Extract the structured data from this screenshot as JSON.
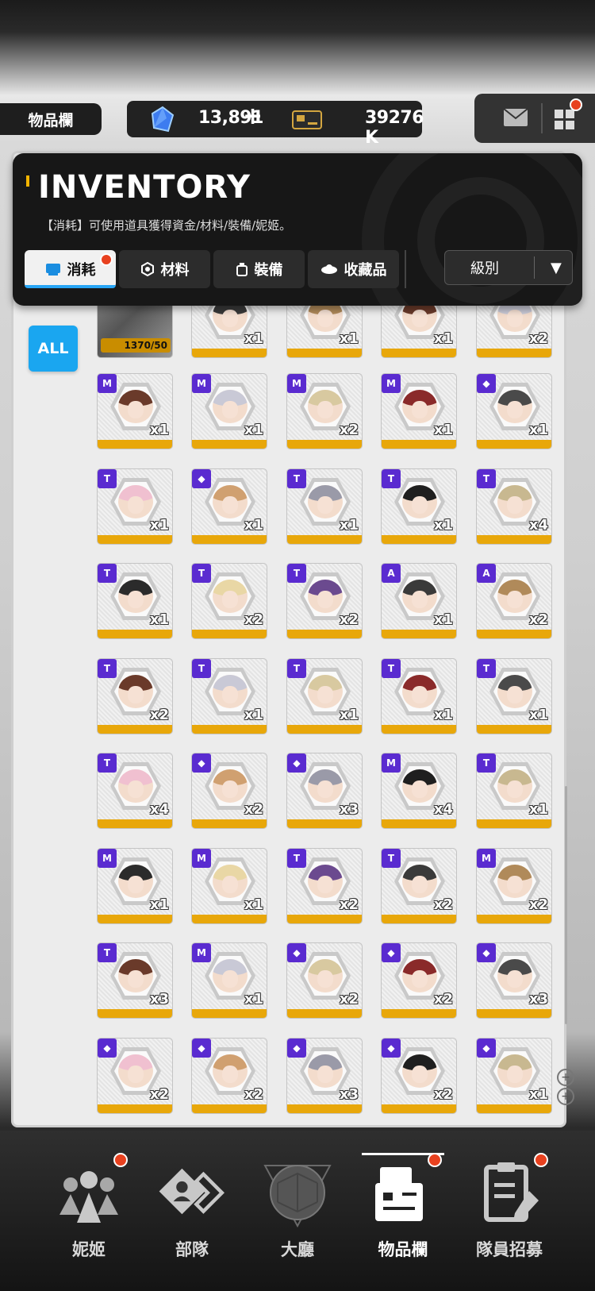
{
  "header": {
    "page_title": "物品欄",
    "gems": "13,891",
    "plus": "+",
    "credits": "39276 K"
  },
  "inventory": {
    "title": "INVENTORY",
    "description": "【消耗】可使用道具獲得資金/材料/裝備/妮姬。",
    "tabs": [
      "消耗",
      "材料",
      "裝備",
      "收藏品"
    ],
    "active_tab": 0,
    "sort_label": "級別",
    "filter_all": "ALL"
  },
  "partial_row": {
    "progress_text": "1370/50",
    "quantities": [
      "x1",
      "x1",
      "x1",
      "x2"
    ]
  },
  "rows": [
    {
      "badges": [
        "M",
        "M",
        "M",
        "M",
        "◆"
      ],
      "quantities": [
        "x1",
        "x1",
        "x2",
        "x1",
        "x1"
      ]
    },
    {
      "badges": [
        "T",
        "◆",
        "T",
        "T",
        "T"
      ],
      "quantities": [
        "x1",
        "x1",
        "x1",
        "x1",
        "x4"
      ]
    },
    {
      "badges": [
        "T",
        "T",
        "T",
        "A",
        "A"
      ],
      "quantities": [
        "x1",
        "x2",
        "x2",
        "x1",
        "x2"
      ]
    },
    {
      "badges": [
        "T",
        "T",
        "T",
        "T",
        "T"
      ],
      "quantities": [
        "x2",
        "x1",
        "x1",
        "x1",
        "x1"
      ]
    },
    {
      "badges": [
        "T",
        "◆",
        "◆",
        "M",
        "T"
      ],
      "quantities": [
        "x4",
        "x2",
        "x3",
        "x4",
        "x1"
      ]
    },
    {
      "badges": [
        "M",
        "M",
        "T",
        "T",
        "M"
      ],
      "quantities": [
        "x1",
        "x1",
        "x2",
        "x2",
        "x2"
      ]
    },
    {
      "badges": [
        "T",
        "M",
        "◆",
        "◆",
        "◆"
      ],
      "quantities": [
        "x3",
        "x1",
        "x2",
        "x2",
        "x3"
      ]
    },
    {
      "badges": [
        "◆",
        "◆",
        "◆",
        "◆",
        "◆"
      ],
      "quantities": [
        "x2",
        "x2",
        "x3",
        "x2",
        "x1"
      ]
    }
  ],
  "colors": {
    "accent_blue": "#1aa6f0",
    "card_yellow": "#e8a70a",
    "badge_purple": "#5a2bd0",
    "notify_red": "#e8411f"
  },
  "bottom_nav": [
    {
      "label": "妮姬",
      "icon": "nikke-group-icon"
    },
    {
      "label": "部隊",
      "icon": "squad-icon"
    },
    {
      "label": "大廳",
      "icon": "lobby-icon"
    },
    {
      "label": "物品欄",
      "icon": "inventory-icon"
    },
    {
      "label": "隊員招募",
      "icon": "recruit-icon"
    }
  ]
}
